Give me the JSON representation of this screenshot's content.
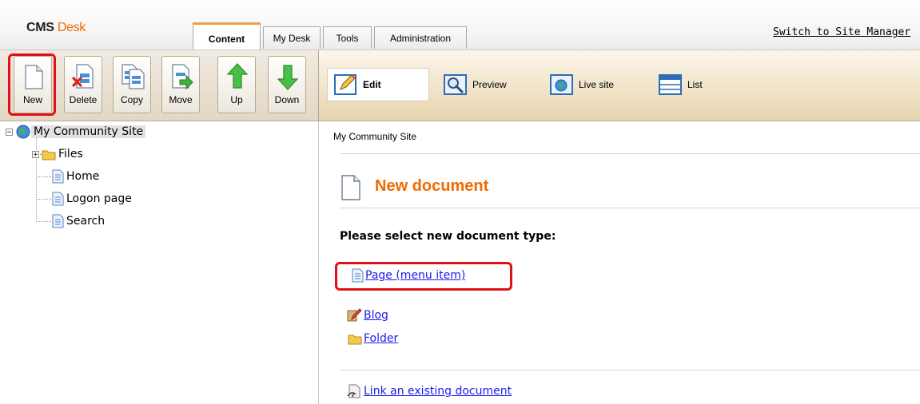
{
  "header": {
    "logo_cms": "CMS",
    "logo_desk": "Desk",
    "tabs": [
      {
        "label": "Content",
        "active": true
      },
      {
        "label": "My Desk",
        "active": false
      },
      {
        "label": "Tools",
        "active": false
      },
      {
        "label": "Administration",
        "active": false
      }
    ],
    "switch_link": "Switch to Site Manager"
  },
  "toolbar": {
    "buttons": [
      {
        "label": "New",
        "icon": "new-document-icon",
        "highlighted": true
      },
      {
        "label": "Delete",
        "icon": "delete-document-icon"
      },
      {
        "label": "Copy",
        "icon": "copy-document-icon"
      },
      {
        "label": "Move",
        "icon": "move-document-icon"
      },
      {
        "label": "Up",
        "icon": "arrow-up-icon"
      },
      {
        "label": "Down",
        "icon": "arrow-down-icon"
      }
    ],
    "modes": [
      {
        "label": "Edit",
        "icon": "edit-icon",
        "active": true
      },
      {
        "label": "Preview",
        "icon": "preview-icon"
      },
      {
        "label": "Live site",
        "icon": "live-site-icon"
      },
      {
        "label": "List",
        "icon": "list-icon"
      }
    ]
  },
  "tree": {
    "root": "My Community Site",
    "children": [
      {
        "label": "Files",
        "type": "folder",
        "expandable": true
      },
      {
        "label": "Home",
        "type": "page"
      },
      {
        "label": "Logon page",
        "type": "page"
      },
      {
        "label": "Search",
        "type": "page"
      }
    ]
  },
  "content": {
    "breadcrumb": "My Community Site",
    "title": "New document",
    "prompt": "Please select new document type:",
    "doc_types": [
      {
        "label": "Page (menu item)",
        "icon": "page-icon",
        "highlighted": true
      },
      {
        "label": "Blog",
        "icon": "blog-icon"
      },
      {
        "label": "Folder",
        "icon": "folder-icon"
      }
    ],
    "link_existing": "Link an existing document"
  },
  "colors": {
    "accent_orange": "#f06a00",
    "highlight_red": "#e0101a",
    "link_blue": "#1a1aee"
  }
}
